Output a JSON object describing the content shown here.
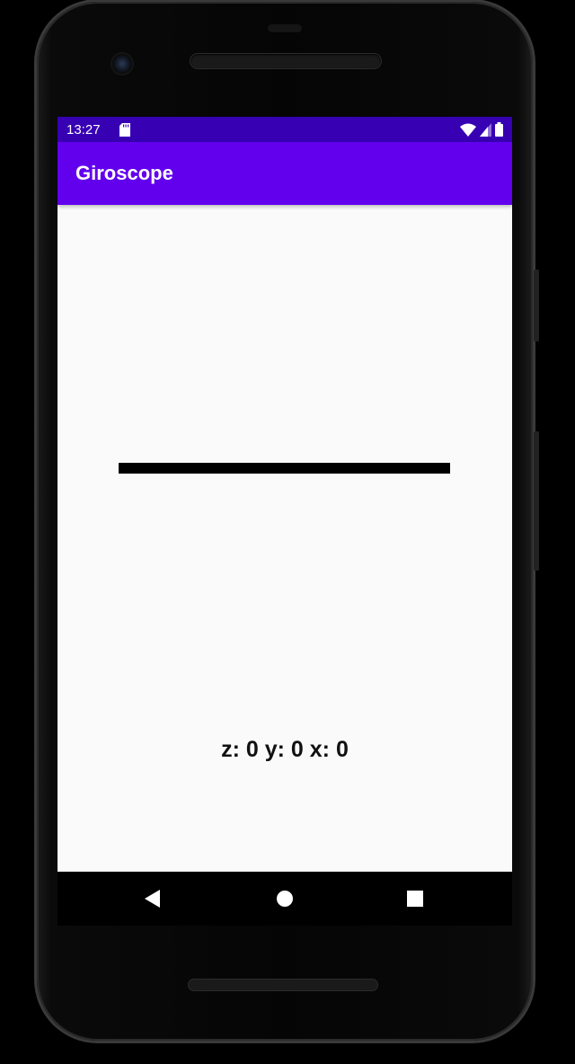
{
  "status_bar": {
    "time": "13:27",
    "icons": [
      "sd-card-icon",
      "wifi-icon",
      "cell-signal-icon",
      "battery-icon"
    ]
  },
  "app_bar": {
    "title": "Giroscope"
  },
  "main": {
    "readout": "z: 0 y: 0 x: 0",
    "horizon_line_color": "#000000"
  },
  "nav_bar": {
    "buttons": [
      "back-icon",
      "home-icon",
      "recents-icon"
    ]
  },
  "colors": {
    "status_bar": "#3700b3",
    "app_bar": "#6200ee",
    "background": "#fafafa",
    "text": "#111111"
  }
}
